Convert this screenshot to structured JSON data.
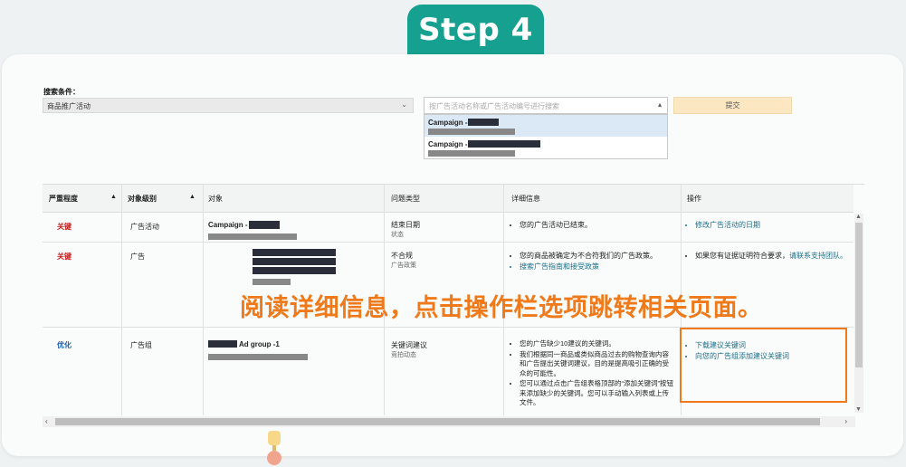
{
  "step_title": "Step 4",
  "search": {
    "label": "搜索条件：",
    "select_value": "商品推广活动",
    "input_placeholder": "按广告活动名称或广告活动编号进行搜索",
    "submit_label": "提交",
    "results": [
      {
        "label": "Campaign -"
      },
      {
        "label": "Campaign -"
      }
    ]
  },
  "table": {
    "headers": {
      "severity": "严重程度",
      "target_level": "对象级别",
      "object": "对象",
      "issue_type": "问题类型",
      "details": "详细信息",
      "action": "操作"
    },
    "rows": [
      {
        "severity": "关键",
        "level": "广告活动",
        "object": "Campaign -",
        "issue_main": "结束日期",
        "issue_sub": "状态",
        "details": [
          "您的广告活动已结束。"
        ],
        "actions": [
          "修改广告活动的日期"
        ]
      },
      {
        "severity": "关键",
        "level": "广告",
        "object": "",
        "issue_main": "不合规",
        "issue_sub": "广告政策",
        "details": [
          "您的商品被确定为不合符我们的广告政策。",
          "搜索广告指南和接受政策"
        ],
        "action_text": "如果您有证据证明符合要求，",
        "action_link": "请联系支持团队。"
      },
      {
        "severity": "优化",
        "level": "广告组",
        "object": "Ad group -1",
        "issue_main": "关键词建议",
        "issue_sub": "竞拍动态",
        "details": [
          "您的广告缺少10建议的关键词。",
          "我们根据同一商品或类似商品过去的购物查询内容和广告提出关键词建议，目的是提高吸引正确的受众的可能性。",
          "您可以通过点击广告组表格顶部的“添加关键词”按钮来添加缺少的关键词。您可以手动输入列表或上传文件。"
        ],
        "actions": [
          "下载建议关键词",
          "向您的广告组添加建议关键词"
        ]
      }
    ]
  },
  "overlay_text": "阅读详细信息，点击操作栏选项跳转相关页面。",
  "colors": {
    "step_badge": "#16a08f",
    "critical": "#c0201c",
    "optimize": "#1a5fb4",
    "overlay": "#f07a1a",
    "link": "#1a6f8a"
  },
  "icons": {
    "sort": "chevron-up-icon",
    "scroll_left": "chevron-left-icon",
    "scroll_right": "chevron-right-icon"
  }
}
